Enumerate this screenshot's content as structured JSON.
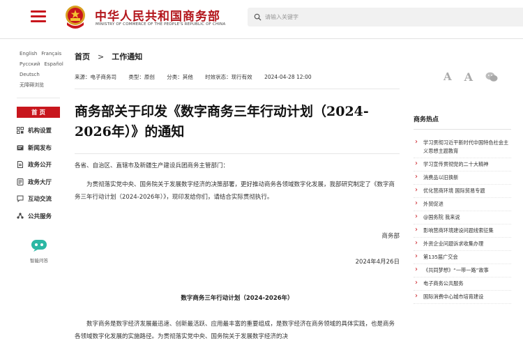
{
  "header": {
    "logo_cn": "中华人民共和国商务部",
    "logo_en": "MINISTRY OF COMMERCE OF THE PEOPLE'S REPUBLIC OF CHINA",
    "search_placeholder": "请输入关键字"
  },
  "languages": {
    "row1": [
      "English",
      "Français"
    ],
    "row2": [
      "Русский",
      "Español"
    ],
    "row3": [
      "Deutsch"
    ],
    "accessible": "无障碍浏览"
  },
  "nav": {
    "home": "首 页",
    "items": [
      {
        "label": "机构设置",
        "icon": "org-chart-icon"
      },
      {
        "label": "新闻发布",
        "icon": "news-icon"
      },
      {
        "label": "政务公开",
        "icon": "document-icon"
      },
      {
        "label": "政务大厅",
        "icon": "hall-icon"
      },
      {
        "label": "互动交流",
        "icon": "chat-icon"
      },
      {
        "label": "公共服务",
        "icon": "service-icon"
      }
    ],
    "assistant": "智能问答"
  },
  "breadcrumb": {
    "home": "首页",
    "arrow": ">",
    "current": "工作通知"
  },
  "meta": {
    "source": "来源：电子商务司",
    "type": "类型：原创",
    "category": "分类：其他",
    "validity": "时效状态：现行有效",
    "date": "2024-04-28 12:00"
  },
  "tools": {
    "font_small": "A",
    "font_large": "A"
  },
  "article": {
    "title": "商务部关于印发《数字商务三年行动计划（2024-2026年）》的通知",
    "addressee": "各省、自治区、直辖市及新疆生产建设兵团商务主管部门：",
    "para1": "为贯彻落实党中央、国务院关于发展数字经济的决策部署，更好推动商务各领域数字化发展，我部研究制定了《数字商务三年行动计划（2024-2026年）》，现印发给你们，请结合实际贯彻执行。",
    "signer": "商务部",
    "sign_date": "2024年4月26日",
    "plan_title": "数字商务三年行动计划（2024-2026年）",
    "para2": "数字商务是数字经济发展最迅速、创新最活跃、应用最丰富的重要组成，是数字经济在商务领域的具体实践，也是商务各领域数字化发展的实施路径。为贯彻落实党中央、国务院关于发展数字经济的决"
  },
  "hot": {
    "head": "商务热点",
    "items": [
      "学习贯彻习近平新时代中国特色社会主义思想主题教育",
      "学习宣传贯彻党的二十大精神",
      "消费品以旧换新",
      "优化营商环境 国际贸易专题",
      "外贸促进",
      "@国务院 我来说",
      "影响营商环境建设问题线索征集",
      "外资企业问题诉求收集办理",
      "第135届广交会",
      "《共同梦想》“一带一路”故事",
      "电子商务公共服务",
      "国际消费中心城市培育建设"
    ]
  },
  "colors": {
    "brand_red": "#c8161d"
  }
}
